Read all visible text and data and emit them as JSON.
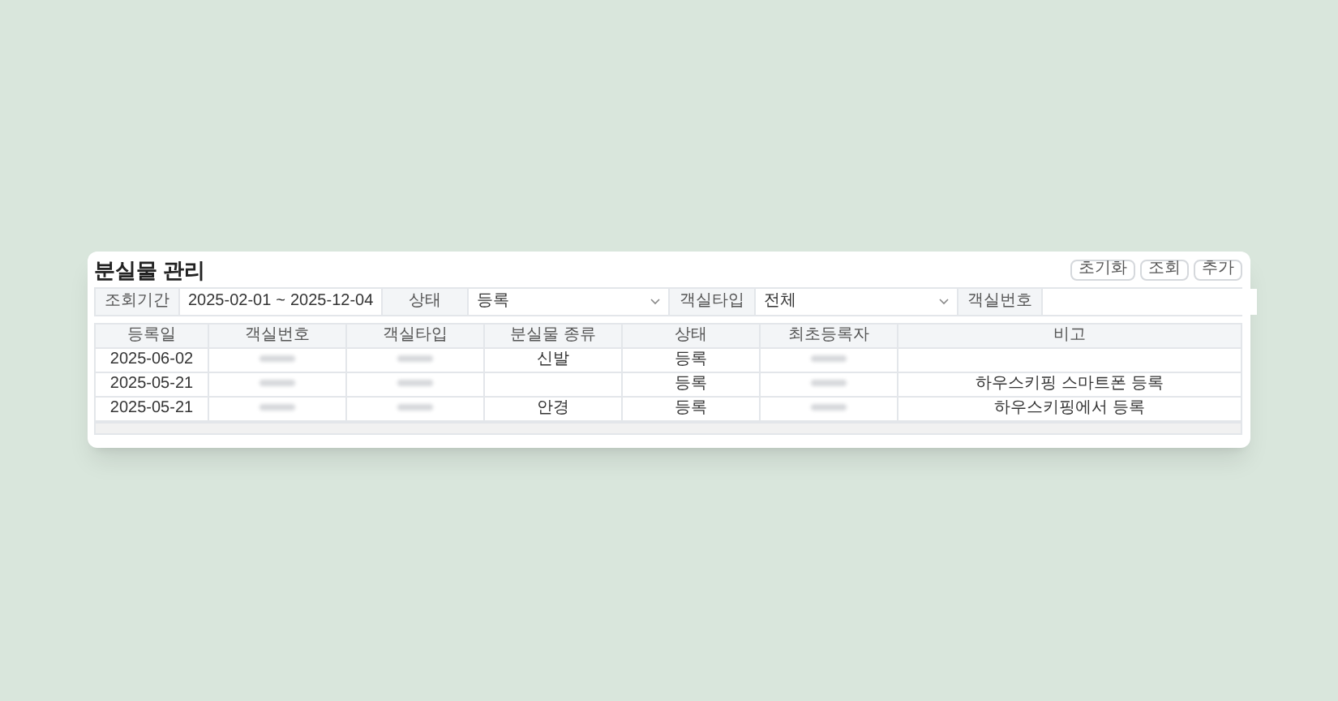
{
  "title": "분실물 관리",
  "buttons": [
    "초기화",
    "조회",
    "추가"
  ],
  "filters": [
    {
      "kind": "label",
      "text": "조회기간"
    },
    {
      "kind": "daterange",
      "from": "2025-02-01",
      "separator": "~",
      "to": "2025-12-04"
    },
    {
      "kind": "label",
      "text": "상태"
    },
    {
      "kind": "select",
      "value": "등록"
    },
    {
      "kind": "label",
      "text": "객실타입"
    },
    {
      "kind": "select",
      "value": "전체"
    },
    {
      "kind": "label",
      "text": "객실번호"
    },
    {
      "kind": "input"
    }
  ],
  "table": {
    "columns": [
      "등록일",
      "객실번호",
      "객실타입",
      "분실물 종류",
      "상태",
      "최초등록자",
      "비고"
    ],
    "rows": [
      [
        {
          "kind": "text",
          "text": "2025-06-02"
        },
        {
          "kind": "redacted"
        },
        {
          "kind": "redacted"
        },
        {
          "kind": "text",
          "text": "신발"
        },
        {
          "kind": "text",
          "text": "등록"
        },
        {
          "kind": "redacted"
        },
        {
          "kind": "empty"
        }
      ],
      [
        {
          "kind": "text",
          "text": "2025-05-21"
        },
        {
          "kind": "redacted"
        },
        {
          "kind": "redacted"
        },
        {
          "kind": "empty"
        },
        {
          "kind": "text",
          "text": "등록"
        },
        {
          "kind": "redacted"
        },
        {
          "kind": "text",
          "text": "하우스키핑 스마트폰 등록"
        }
      ],
      [
        {
          "kind": "text",
          "text": "2025-05-21"
        },
        {
          "kind": "redacted"
        },
        {
          "kind": "redacted"
        },
        {
          "kind": "text",
          "text": "안경"
        },
        {
          "kind": "text",
          "text": "등록"
        },
        {
          "kind": "redacted"
        },
        {
          "kind": "text",
          "text": "하우스키핑에서 등록"
        }
      ]
    ]
  }
}
